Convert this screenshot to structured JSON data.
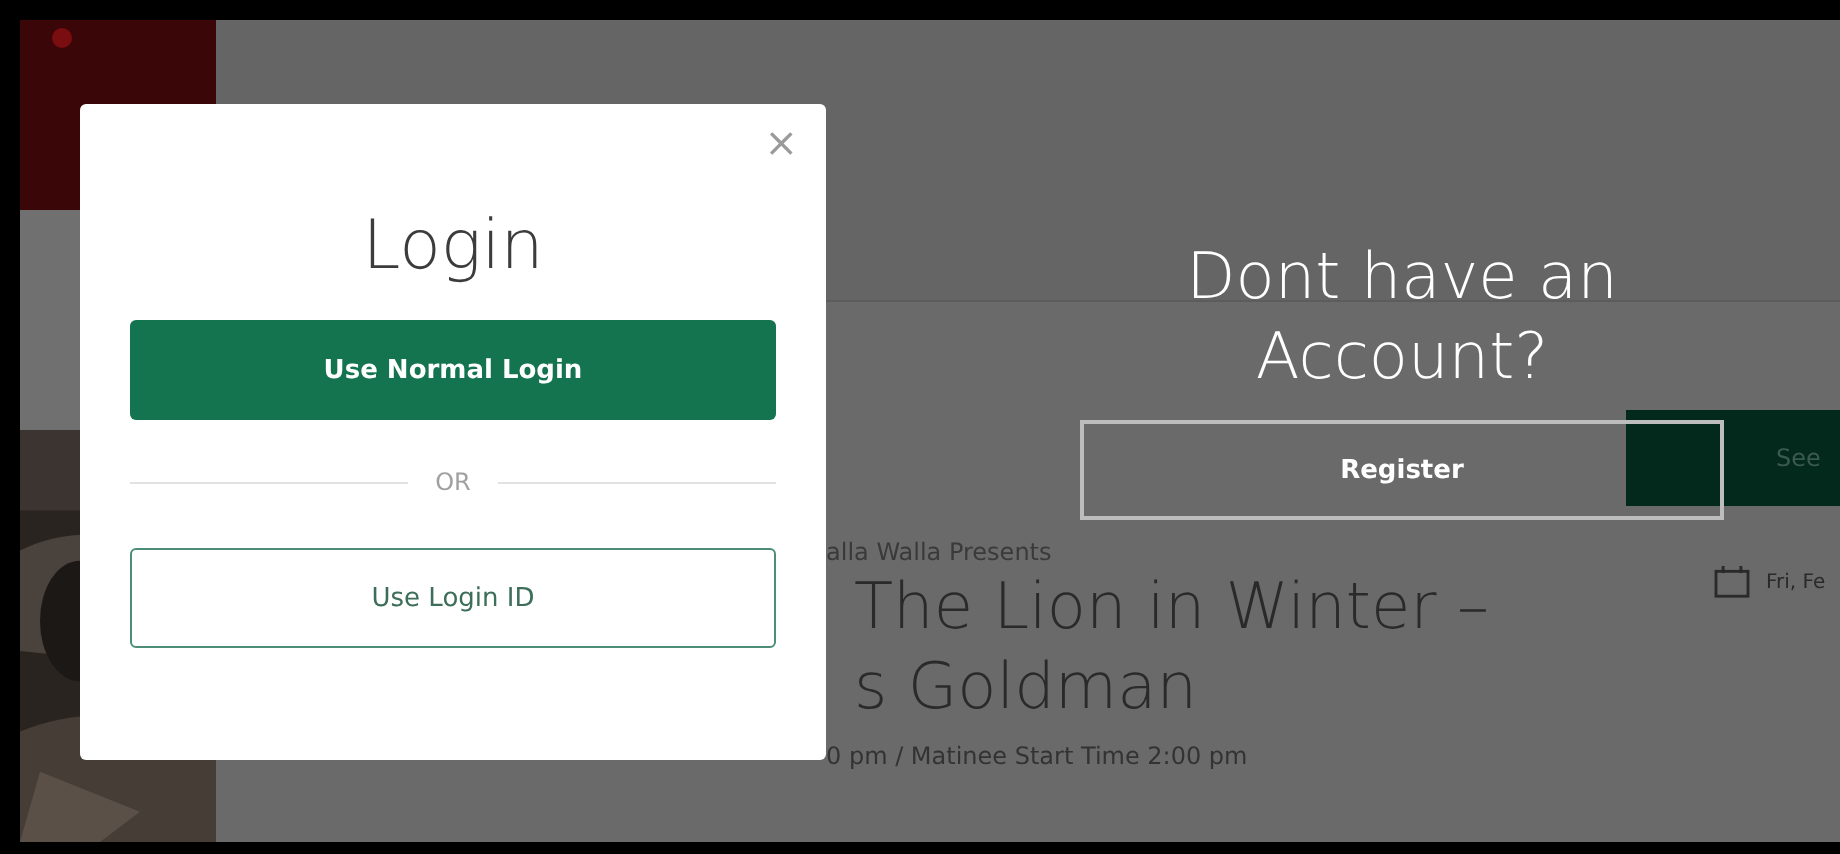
{
  "background": {
    "presenter": "alla Walla Presents",
    "title_lines": [
      "The Lion in Winter –",
      "s Goldman"
    ],
    "times": "0 pm / Matinee Start Time 2:00 pm",
    "see_button": "See",
    "date": "Fri, Fe"
  },
  "login_modal": {
    "close": "×",
    "title": "Login",
    "divider": "OR",
    "buttons": [
      {
        "label": "Use Normal Login",
        "kind": "primary"
      },
      {
        "label": "Use Login ID",
        "kind": "outline"
      }
    ]
  },
  "register_panel": {
    "heading": "Dont have an Account?",
    "button": "Register"
  }
}
